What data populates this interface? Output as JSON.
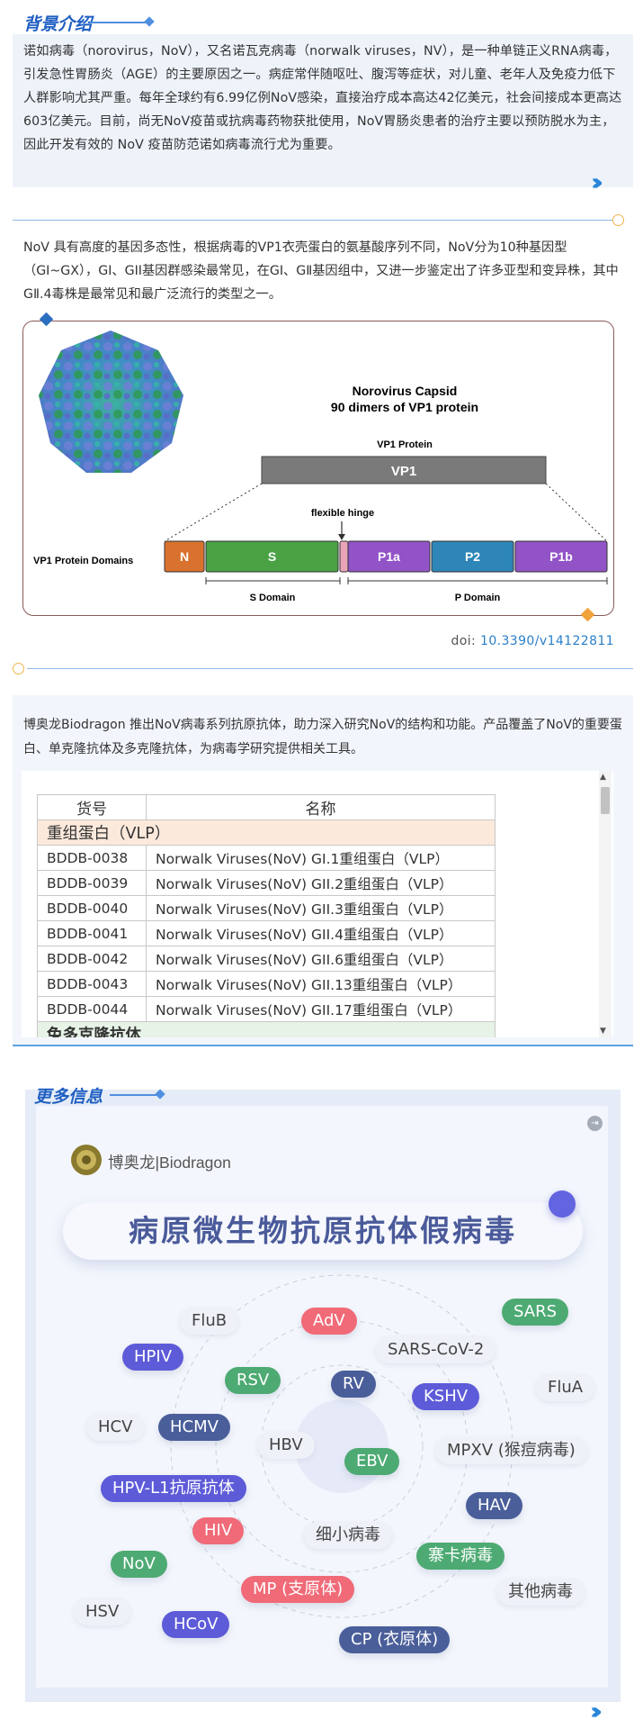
{
  "section_background": {
    "title": "背景介绍",
    "paragraph": "诺如病毒（norovirus，NoV），又名诺瓦克病毒（norwalk viruses，NV），是一种单链正义RNA病毒，引发急性胃肠炎（AGE）的主要原因之一。病症常伴随呕吐、腹泻等症状，对儿童、老年人及免疫力低下人群影响尤其严重。每年全球约有6.99亿例NoV感染，直接治疗成本高达42亿美元，社会间接成本更高达603亿美元。目前，尚无NoV疫苗或抗病毒药物获批使用，NoV胃肠炎患者的治疗主要以预防脱水为主，因此开发有效的 NoV 疫苗防范诺如病毒流行尤为重要。",
    "more_icon": "double-chevron-right"
  },
  "section_genotype": {
    "paragraph": "NoV 具有高度的基因多态性，根据病毒的VP1衣壳蛋白的氨基酸序列不同，NoV分为10种基因型（GⅠ~GⅩ），GI、GII基因群感染最常见，在GⅠ、GⅡ基因组中，又进一步鉴定出了许多亚型和变异株，其中GⅡ.4毒株是最常见和最广泛流行的类型之一。"
  },
  "figure": {
    "capsid_title_line1": "Norovirus Capsid",
    "capsid_title_line2": "90 dimers of VP1 protein",
    "vp1_label": "VP1 Protein",
    "vp1_bar": "VP1",
    "hinge_label": "flexible hinge",
    "domains_label": "VP1 Protein Domains",
    "domains": [
      {
        "label": "N",
        "color": "#d9722e"
      },
      {
        "label": "S",
        "color": "#4aa245"
      },
      {
        "label": "",
        "color": "#e9a5b7"
      },
      {
        "label": "P1a",
        "color": "#9253c7"
      },
      {
        "label": "P2",
        "color": "#2e86b8"
      },
      {
        "label": "P1b",
        "color": "#9253c7"
      }
    ],
    "s_domain_label": "S Domain",
    "p_domain_label": "P Domain",
    "doi_prefix": "doi: ",
    "doi_value": "10.3390/v14122811"
  },
  "section_products": {
    "paragraph": "博奥龙Biodragon 推出NoV病毒系列抗原抗体，助力深入研究NoV的结构和功能。产品覆盖了NoV的重要蛋白、单克隆抗体及多克隆抗体，为病毒学研究提供相关工具。",
    "table": {
      "headers": [
        "货号",
        "名称"
      ],
      "group1": "重组蛋白（VLP）",
      "rows": [
        [
          "BDDB-0038",
          "Norwalk Viruses(NoV) GI.1重组蛋白（VLP）"
        ],
        [
          "BDDB-0039",
          "Norwalk Viruses(NoV) GII.2重组蛋白（VLP）"
        ],
        [
          "BDDB-0040",
          "Norwalk Viruses(NoV) GII.3重组蛋白（VLP）"
        ],
        [
          "BDDB-0041",
          "Norwalk Viruses(NoV) GII.4重组蛋白（VLP）"
        ],
        [
          "BDDB-0042",
          "Norwalk Viruses(NoV) GII.6重组蛋白（VLP）"
        ],
        [
          "BDDB-0043",
          "Norwalk Viruses(NoV) GII.13重组蛋白（VLP）"
        ],
        [
          "BDDB-0044",
          "Norwalk Viruses(NoV) GII.17重组蛋白（VLP）"
        ]
      ],
      "group2": "兔多克隆抗体"
    }
  },
  "section_more": {
    "title": "更多信息",
    "brand": "博奥龙|Biodragon",
    "banner": "病原微生物抗原抗体假病毒",
    "pills": [
      {
        "label": "FluB",
        "style": "plain"
      },
      {
        "label": "AdV",
        "style": "red"
      },
      {
        "label": "SARS",
        "style": "green"
      },
      {
        "label": "HPIV",
        "style": "purple"
      },
      {
        "label": "SARS-CoV-2",
        "style": "plain"
      },
      {
        "label": "RSV",
        "style": "green"
      },
      {
        "label": "RV",
        "style": "slate"
      },
      {
        "label": "KSHV",
        "style": "purple"
      },
      {
        "label": "FluA",
        "style": "plain"
      },
      {
        "label": "HCV",
        "style": "plain"
      },
      {
        "label": "HCMV",
        "style": "slate"
      },
      {
        "label": "HBV",
        "style": "plain"
      },
      {
        "label": "EBV",
        "style": "green"
      },
      {
        "label": "MPXV (猴痘病毒)",
        "style": "plain"
      },
      {
        "label": "HPV-L1抗原抗体",
        "style": "purple"
      },
      {
        "label": "HAV",
        "style": "slate"
      },
      {
        "label": "HIV",
        "style": "red"
      },
      {
        "label": "细小病毒",
        "style": "plain"
      },
      {
        "label": "寨卡病毒",
        "style": "green"
      },
      {
        "label": "NoV",
        "style": "green"
      },
      {
        "label": "MP (支原体)",
        "style": "red"
      },
      {
        "label": "其他病毒",
        "style": "plain"
      },
      {
        "label": "HSV",
        "style": "plain"
      },
      {
        "label": "HCoV",
        "style": "purple"
      },
      {
        "label": "CP (衣原体)",
        "style": "slate"
      }
    ]
  }
}
